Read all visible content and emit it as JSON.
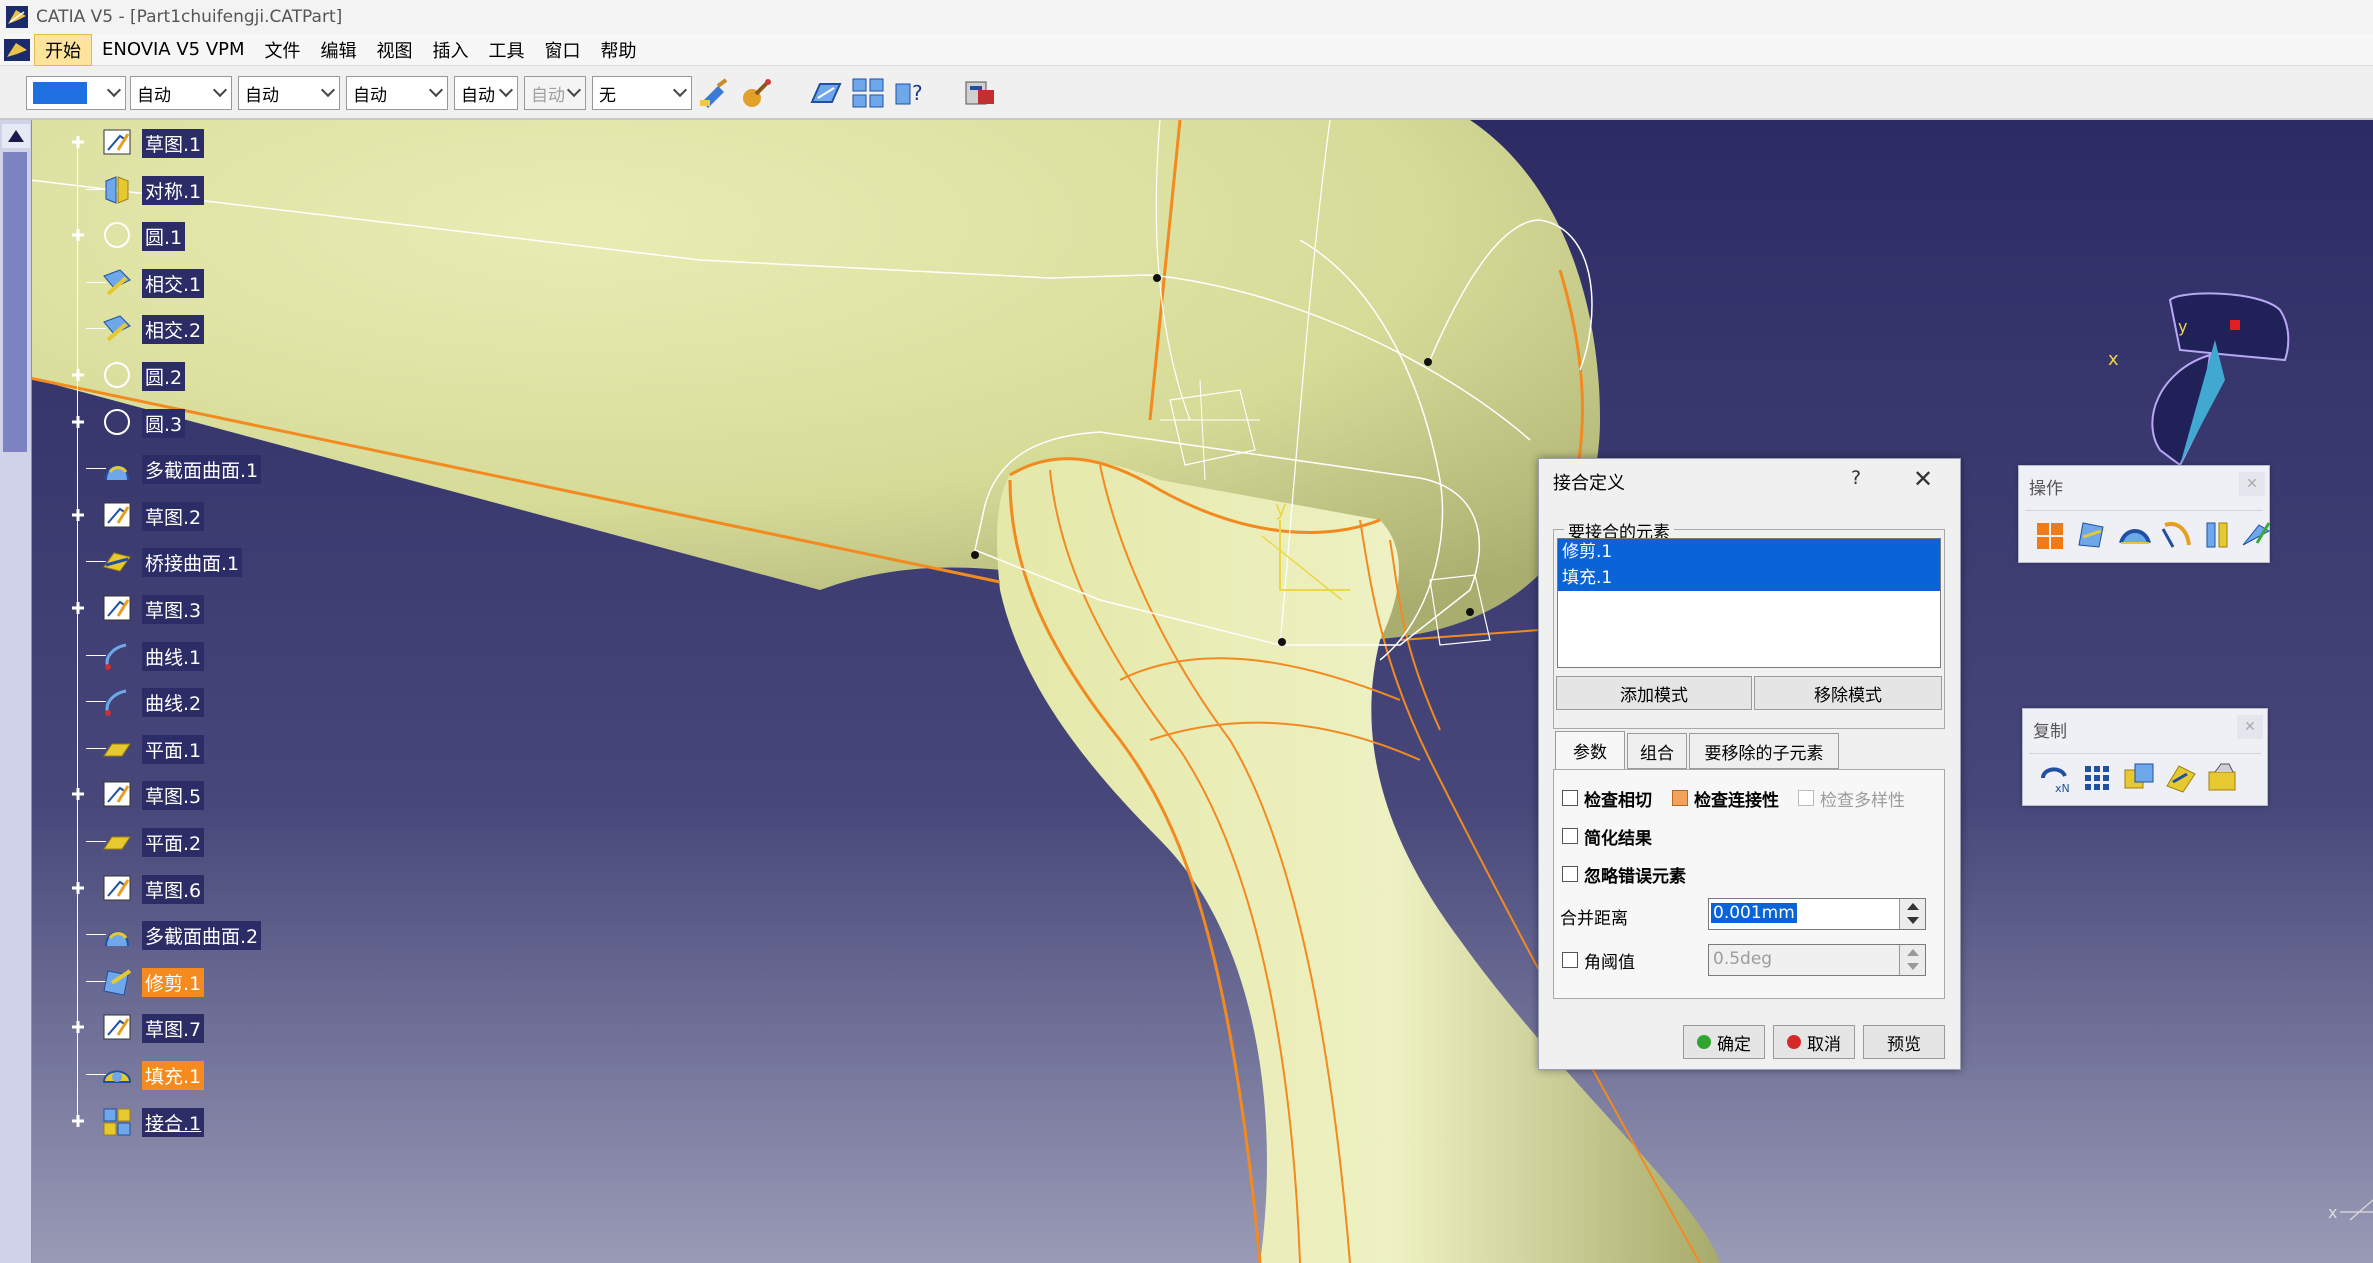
{
  "window": {
    "title": "CATIA V5 - [Part1chuifengji.CATPart]"
  },
  "menu": [
    "开始",
    "ENOVIA V5 VPM",
    "文件",
    "编辑",
    "视图",
    "插入",
    "工具",
    "窗口",
    "帮助"
  ],
  "toolbar": {
    "color_swatch": "#1e6fe0",
    "selects": [
      {
        "value": "自动",
        "disabled": false
      },
      {
        "value": "自动",
        "disabled": false
      },
      {
        "value": "自动",
        "disabled": false
      },
      {
        "value": "自动",
        "disabled": false
      },
      {
        "value": "自动",
        "disabled": true
      },
      {
        "value": "无",
        "disabled": false
      }
    ]
  },
  "tree": [
    {
      "label": "草图.1",
      "icon": "sketch-icon",
      "expand": true
    },
    {
      "label": "对称.1",
      "icon": "symmetry-icon",
      "expand": false
    },
    {
      "label": "圆.1",
      "icon": "circle-icon",
      "expand": true
    },
    {
      "label": "相交.1",
      "icon": "intersect-icon",
      "expand": false
    },
    {
      "label": "相交.2",
      "icon": "intersect-icon",
      "expand": false
    },
    {
      "label": "圆.2",
      "icon": "circle-icon",
      "expand": true
    },
    {
      "label": "圆.3",
      "icon": "circle-icon",
      "expand": true
    },
    {
      "label": "多截面曲面.1",
      "icon": "multisection-icon",
      "expand": false
    },
    {
      "label": "草图.2",
      "icon": "sketch-icon",
      "expand": true
    },
    {
      "label": "桥接曲面.1",
      "icon": "blend-icon",
      "expand": false
    },
    {
      "label": "草图.3",
      "icon": "sketch-icon",
      "expand": true
    },
    {
      "label": "曲线.1",
      "icon": "curve-icon",
      "expand": false
    },
    {
      "label": "曲线.2",
      "icon": "curve-icon",
      "expand": false
    },
    {
      "label": "平面.1",
      "icon": "plane-icon",
      "expand": false
    },
    {
      "label": "草图.5",
      "icon": "sketch-icon",
      "expand": true
    },
    {
      "label": "平面.2",
      "icon": "plane-icon",
      "expand": false
    },
    {
      "label": "草图.6",
      "icon": "sketch-icon",
      "expand": true
    },
    {
      "label": "多截面曲面.2",
      "icon": "multisection-icon",
      "expand": false
    },
    {
      "label": "修剪.1",
      "icon": "trim-icon",
      "expand": false,
      "selected": true
    },
    {
      "label": "草图.7",
      "icon": "sketch-icon",
      "expand": true
    },
    {
      "label": "填充.1",
      "icon": "fill-icon",
      "expand": false,
      "selected": true
    },
    {
      "label": "接合.1",
      "icon": "join-icon",
      "expand": true,
      "underline": true
    }
  ],
  "dialog": {
    "title": "接合定义",
    "help": "?",
    "elements_group": "要接合的元素",
    "elements": [
      "修剪.1",
      "填充.1"
    ],
    "add_mode": "添加模式",
    "remove_mode": "移除模式",
    "tabs": [
      "参数",
      "组合",
      "要移除的子元素"
    ],
    "check_tangency": "检查相切",
    "check_connexity": "检查连接性",
    "check_manifold": "检查多样性",
    "simplify": "简化结果",
    "ignore_errors": "忽略错误元素",
    "merge_distance_label": "合并距离",
    "merge_distance": "0.001mm",
    "angular_label": "角阈值",
    "angular_value": "0.5deg",
    "ok": "确定",
    "cancel": "取消",
    "preview": "预览"
  },
  "palettes": {
    "operations": "操作",
    "replication": "复制"
  },
  "compass": {
    "x": "x",
    "y": "y"
  },
  "axis_labels": {
    "y": "y",
    "x": "x"
  },
  "colors": {
    "accent_orange": "#f58a1f",
    "selection_blue": "#0a64d8",
    "surface": "#dfe3a2",
    "background": "#2f2f5c"
  }
}
